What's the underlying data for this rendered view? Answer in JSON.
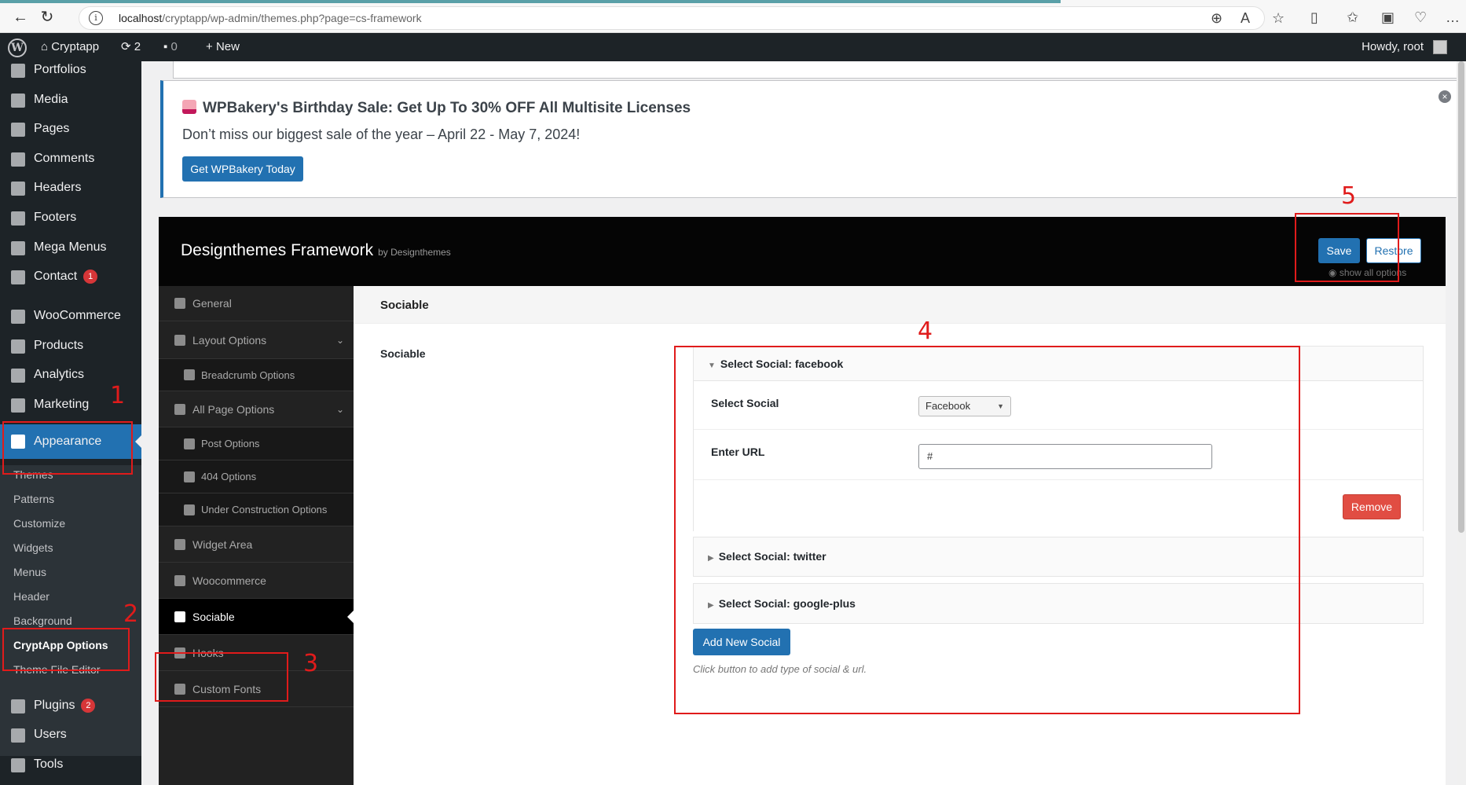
{
  "browser": {
    "url_host": "localhost",
    "url_path": "/cryptapp/wp-admin/themes.php?page=cs-framework"
  },
  "adminbar": {
    "site_name": "Cryptapp",
    "updates_count": "2",
    "comments_count": "0",
    "new_label": "New",
    "howdy": "Howdy, root"
  },
  "menu": {
    "items": [
      {
        "label": "Portfolios"
      },
      {
        "label": "Media"
      },
      {
        "label": "Pages"
      },
      {
        "label": "Comments"
      },
      {
        "label": "Headers"
      },
      {
        "label": "Footers"
      },
      {
        "label": "Mega Menus"
      },
      {
        "label": "Contact",
        "badge": "1"
      },
      {
        "label": "WooCommerce"
      },
      {
        "label": "Products"
      },
      {
        "label": "Analytics"
      },
      {
        "label": "Marketing"
      },
      {
        "label": "Appearance"
      },
      {
        "label": "Plugins",
        "badge": "2"
      },
      {
        "label": "Users"
      },
      {
        "label": "Tools"
      }
    ],
    "submenu": [
      "Themes",
      "Patterns",
      "Customize",
      "Widgets",
      "Menus",
      "Header",
      "Background",
      "CryptApp Options",
      "Theme File Editor"
    ]
  },
  "notice": {
    "title": "WPBakery's Birthday Sale: Get Up To 30% OFF All Multisite Licenses",
    "text": "Don’t miss our biggest sale of the year – April 22 - May 7, 2024!",
    "button": "Get WPBakery Today"
  },
  "framework": {
    "title": "Designthemes Framework",
    "by": "by Designthemes",
    "save": "Save",
    "restore": "Restore",
    "show_all": "show all options",
    "nav": [
      {
        "label": "General"
      },
      {
        "label": "Layout Options"
      },
      {
        "label": "Breadcrumb Options"
      },
      {
        "label": "All Page Options"
      },
      {
        "label": "Post Options"
      },
      {
        "label": "404 Options"
      },
      {
        "label": "Under Construction Options"
      },
      {
        "label": "Widget Area"
      },
      {
        "label": "Woocommerce"
      },
      {
        "label": "Sociable"
      },
      {
        "label": "Hooks"
      },
      {
        "label": "Custom Fonts"
      }
    ],
    "section_title": "Sociable",
    "field_label": "Sociable",
    "groups": [
      {
        "title": "Select Social: facebook"
      },
      {
        "title": "Select Social: twitter"
      },
      {
        "title": "Select Social: google-plus"
      }
    ],
    "select_social_label": "Select Social",
    "select_social_value": "Facebook",
    "enter_url_label": "Enter URL",
    "enter_url_value": "#",
    "remove": "Remove",
    "add_new": "Add New Social",
    "help": "Click button to add type of social & url."
  },
  "annotations": [
    "1",
    "2",
    "3",
    "4",
    "5"
  ],
  "colors": {
    "wp_dark": "#1d2327",
    "wp_blue": "#2271b1",
    "annotation_red": "#e01b1b",
    "remove_red": "#e14d43"
  }
}
